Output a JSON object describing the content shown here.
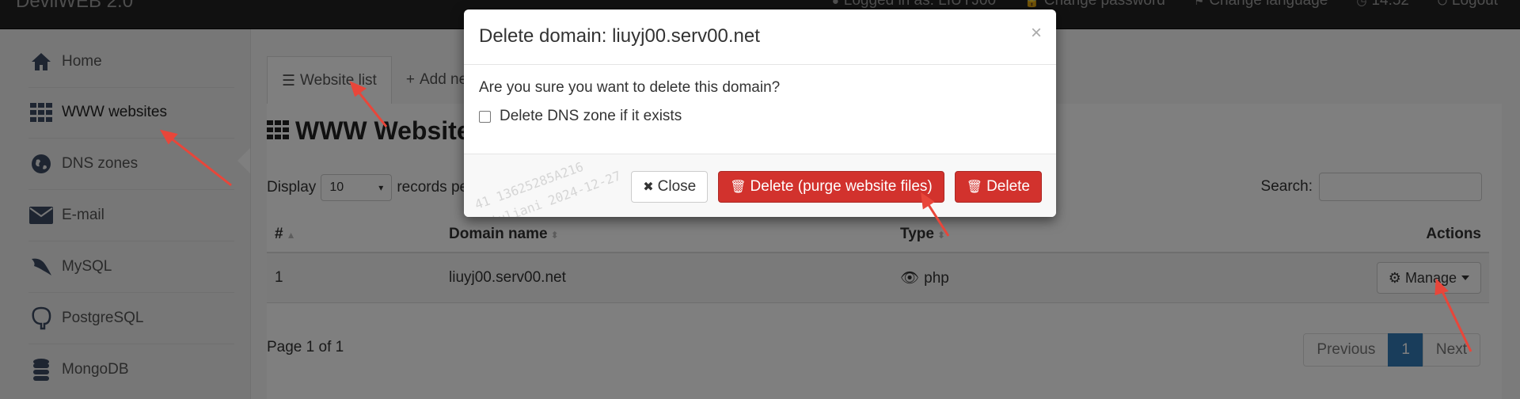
{
  "navbar": {
    "brand": "DevilWEB 2.0",
    "logged_in": "Logged in as: LIUYJ00",
    "change_password": "Change password",
    "change_language": "Change language",
    "time": "14:52",
    "logout": "Logout"
  },
  "sidebar": {
    "items": [
      {
        "label": "Home",
        "icon": "home-icon"
      },
      {
        "label": "WWW websites",
        "icon": "grid-icon"
      },
      {
        "label": "DNS zones",
        "icon": "globe-icon"
      },
      {
        "label": "E-mail",
        "icon": "envelope-icon"
      },
      {
        "label": "MySQL",
        "icon": "dolphin-icon"
      },
      {
        "label": "PostgreSQL",
        "icon": "elephant-icon"
      },
      {
        "label": "MongoDB",
        "icon": "database-icon"
      }
    ]
  },
  "main": {
    "tabs": [
      {
        "label": "Website list"
      },
      {
        "label": "Add new"
      }
    ],
    "heading": "WWW Websites",
    "display_label": "Display",
    "display_value": "10",
    "records_label": "records pe",
    "search_label": "Search:",
    "table": {
      "headers": [
        "#",
        "Domain name",
        "Type",
        "Actions"
      ],
      "rows": [
        {
          "num": "1",
          "domain": "liuyj00.serv00.net",
          "type": "php",
          "action": "Manage"
        }
      ]
    },
    "page_info": "Page 1 of 1",
    "pager": {
      "previous": "Previous",
      "current": "1",
      "next": "Next"
    }
  },
  "modal": {
    "title": "Delete domain: liuyj00.serv00.net",
    "close_symbol": "×",
    "question": "Are you sure you want to delete this domain?",
    "checkbox_label": "Delete DNS zone if it exists",
    "buttons": {
      "close": "Close",
      "purge": "Delete (purge website files)",
      "delete": "Delete"
    }
  },
  "watermark": {
    "line1": "41 13625285A216",
    "line2": "liuliani 2024-12-27"
  },
  "colors": {
    "danger": "#d2322d",
    "primary": "#337ab7",
    "navbar": "#222222",
    "sidebar": "#efefef"
  }
}
